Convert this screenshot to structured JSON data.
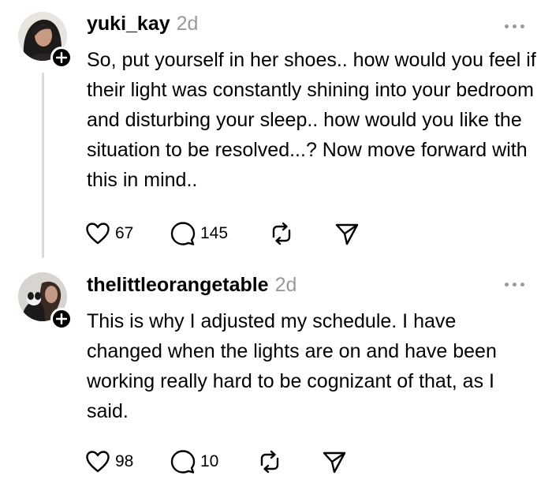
{
  "posts": [
    {
      "username": "yuki_kay",
      "time": "2d",
      "text": "So, put yourself in her shoes.. how would you feel if their light was constantly shining into your bedroom and disturbing your sleep.. how would you like the situation to be resolved...? Now move forward with this in mind..",
      "likes": "67",
      "replies": "145"
    },
    {
      "username": "thelittleorangetable",
      "time": "2d",
      "text": "This is why I adjusted my schedule. I have changed when the lights are on and have been working really hard to be cognizant of that, as I said.",
      "likes": "98",
      "replies": "10"
    }
  ],
  "icons": {
    "like": "heart-icon",
    "reply": "comment-bubble-icon",
    "repost": "repost-icon",
    "share": "send-icon",
    "more": "more-dots-icon",
    "follow": "plus-icon"
  },
  "colors": {
    "text": "#000000",
    "muted": "#9a9a9a",
    "thread_line": "#d9d9d9",
    "background": "#ffffff"
  }
}
